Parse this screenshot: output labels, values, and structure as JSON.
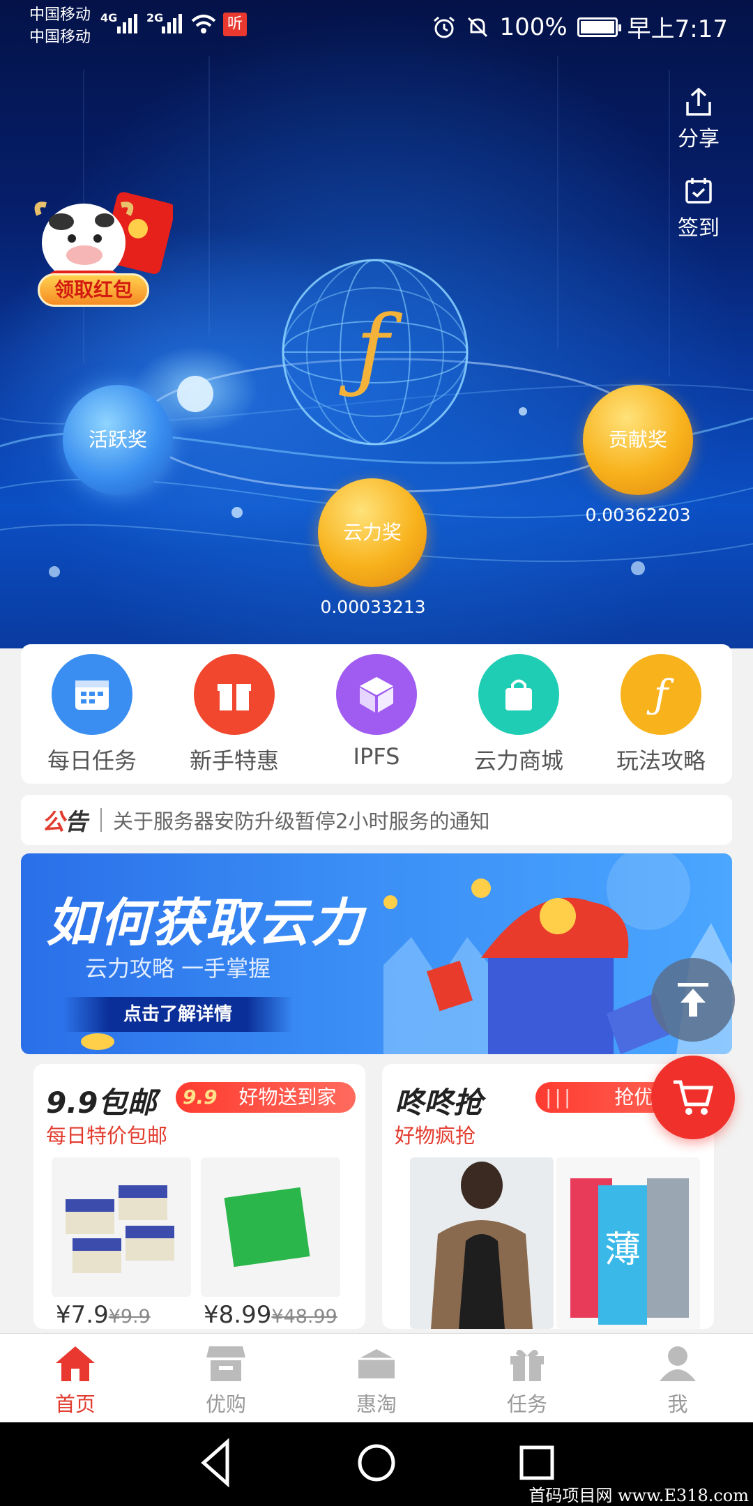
{
  "status_bar": {
    "carrier1": "中国移动",
    "carrier2": "中国移动",
    "net1": "4G",
    "net2": "2G",
    "ting": "听",
    "battery": "100%",
    "time": "早上7:17"
  },
  "hero": {
    "share_label": "分享",
    "checkin_label": "签到",
    "red_packet_label": "领取红包",
    "orbs": {
      "active": "活跃奖",
      "contribution": "贡献奖",
      "contribution_value": "0.00362203",
      "cloud": "云力奖",
      "cloud_value": "0.00033213"
    }
  },
  "menu": [
    {
      "label": "每日任务",
      "icon": "calendar-icon",
      "color": "#3a8ef2"
    },
    {
      "label": "新手特惠",
      "icon": "gift-icon",
      "color": "#f2472f"
    },
    {
      "label": "IPFS",
      "icon": "cube-icon",
      "color": "#a05cf0"
    },
    {
      "label": "云力商城",
      "icon": "shopping-bag-icon",
      "color": "#1fcdb4"
    },
    {
      "label": "玩法攻略",
      "icon": "filecoin-icon",
      "color": "#f8b21c"
    }
  ],
  "notice": {
    "tag_a": "公",
    "tag_b": "告",
    "text": "关于服务器安防升级暂停2小时服务的通知"
  },
  "banner": {
    "title": "如何获取云力",
    "subtitle": "云力攻略  一手掌握",
    "button": "点击了解详情"
  },
  "promo_left": {
    "title": "9.9包邮",
    "pill_badge": "9.9",
    "pill_text": "好物送到家",
    "subtitle": "每日特价包邮",
    "products": [
      {
        "price": "¥7.9",
        "original": "¥9.9"
      },
      {
        "price": "¥8.99",
        "original": "¥48.99"
      }
    ]
  },
  "promo_right": {
    "title": "咚咚抢",
    "pill_text": "抢优惠",
    "subtitle": "好物疯抢"
  },
  "tabbar": [
    {
      "label": "首页",
      "icon": "home-icon",
      "active": true
    },
    {
      "label": "优购",
      "icon": "store-icon",
      "active": false
    },
    {
      "label": "惠淘",
      "icon": "box-icon",
      "active": false
    },
    {
      "label": "任务",
      "icon": "gift-icon",
      "active": false
    },
    {
      "label": "我",
      "icon": "user-icon",
      "active": false
    }
  ],
  "watermark": "首码项目网  www.E318.com",
  "colors": {
    "accent_red": "#e23c2f",
    "orb_gold": "#f8b21c",
    "orb_blue": "#3a8ff0"
  }
}
